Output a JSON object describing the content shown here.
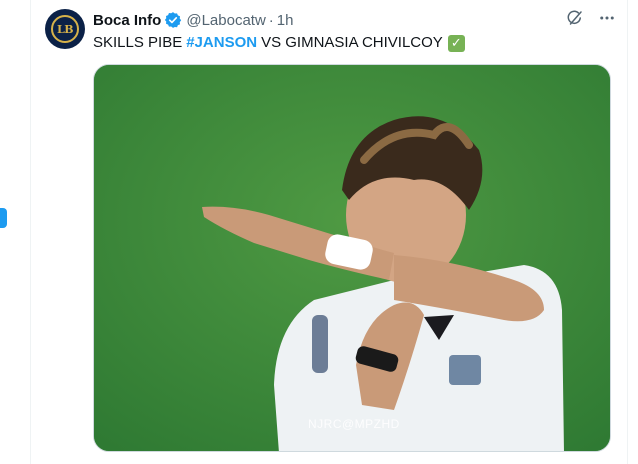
{
  "tweet": {
    "author_name": "Boca Info",
    "handle": "@Labocatw",
    "separator": "·",
    "time": "1h",
    "avatar_text": "LB",
    "text_before": "SKILLS PIBE",
    "hashtag": "#JANSON",
    "text_after": "VS GIMNASIA CHIVILCOY",
    "emoji": "✓",
    "media": {
      "watermark": "NJRC@MPZHD"
    }
  },
  "icons": {
    "verified": "verified-badge-icon",
    "grok": "grok-icon",
    "more": "more-icon"
  },
  "colors": {
    "accent": "#1d9bf0",
    "text": "#0f1419",
    "secondary": "#536471",
    "check_emoji": "#77b255"
  }
}
